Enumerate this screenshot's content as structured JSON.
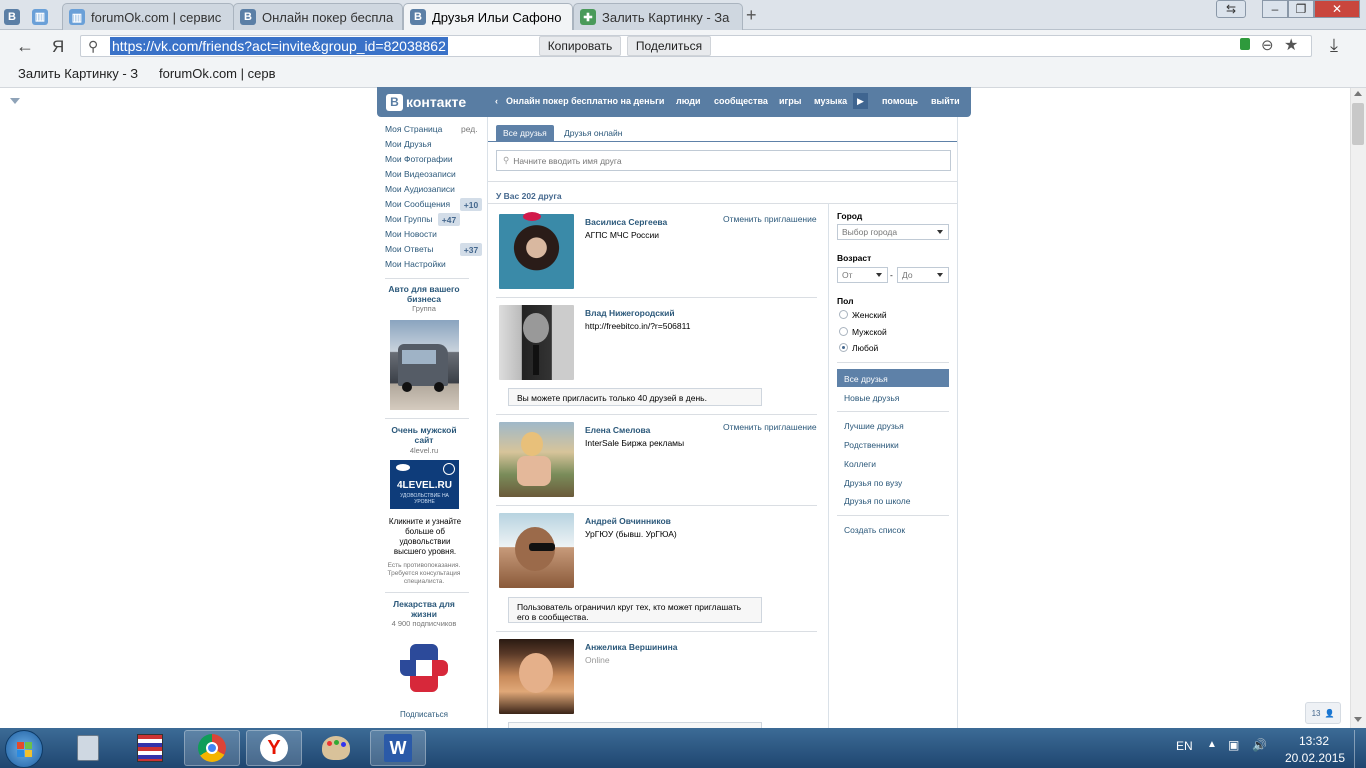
{
  "browser": {
    "tabs": [
      {
        "label": "forumOk.com | сервис"
      },
      {
        "label": "Онлайн покер беспла"
      },
      {
        "label": "Друзья Ильи Сафоно"
      },
      {
        "label": "Залить Картинку - За"
      }
    ],
    "url": "https://vk.com/friends?act=invite&group_id=82038862",
    "copy_label": "Копировать",
    "share_label": "Поделиться",
    "yandex_label": "Я",
    "bookmarks": [
      "Залить Картинку - З",
      "forumOk.com | серв"
    ]
  },
  "vk": {
    "logo": "контакте",
    "logo_b": "В",
    "nav": {
      "promo": "Онлайн покер бесплатно на деньги",
      "people": "люди",
      "communities": "сообщества",
      "games": "игры",
      "music": "музыка",
      "help": "помощь",
      "logout": "выйти"
    },
    "left_menu": {
      "my_page": "Моя Страница",
      "edit": "ред.",
      "friends": "Мои Друзья",
      "photos": "Мои Фотографии",
      "videos": "Мои Видеозаписи",
      "audio": "Мои Аудиозаписи",
      "messages": "Мои Сообщения",
      "messages_count": "+10",
      "groups": "Мои Группы",
      "groups_count": "+47",
      "news": "Мои Новости",
      "answers": "Мои Ответы",
      "answers_count": "+37",
      "settings": "Мои Настройки"
    },
    "ads": {
      "ad1_title": "Авто для вашего бизнеса",
      "ad1_sub": "Группа",
      "ad2_title": "Очень мужской сайт",
      "ad2_sub": "4level.ru",
      "ad2_logo": "4LEVEL.RU",
      "ad2_logo_sub": "УДОВОЛЬСТВИЕ НА УРОВНЕ",
      "ad2_text": "Кликните и узнайте больше об удовольствии высшего уровня.",
      "ad2_disclaimer": "Есть противопоказания. Требуется консультация специалиста.",
      "ad3_title": "Лекарства для жизни",
      "ad3_sub": "4 900 подписчиков",
      "ad3_subscribe": "Подписаться"
    },
    "tabs": {
      "all": "Все друзья",
      "online": "Друзья онлайн"
    },
    "search_placeholder": "Начните вводить имя друга",
    "friends_count": "У Вас 202 друга",
    "cancel_invite": "Отменить приглашение",
    "friends": [
      {
        "name": "Василиса Сергеева",
        "sub": "АГПС МЧС России"
      },
      {
        "name": "Влад Нижегородский",
        "sub": "http://freebitco.in/?r=506811"
      },
      {
        "name": "Елена Смелова",
        "sub": "InterSale Биржа рекламы"
      },
      {
        "name": "Андрей Овчинников",
        "sub": "УрГЮУ (бывш. УрГЮА)"
      },
      {
        "name": "Анжелика Вершинина",
        "sub": "Online"
      }
    ],
    "notice_limit": "Вы можете пригласить только 40 друзей в день.",
    "notice_restricted": "Пользователь ограничил круг тех, кто может приглашать его в сообщества.",
    "filter": {
      "city_label": "Город",
      "city_select": "Выбор города",
      "age_label": "Возраст",
      "age_from": "От",
      "age_dash": "-",
      "age_to": "До",
      "sex_label": "Пол",
      "female": "Женский",
      "male": "Мужской",
      "any": "Любой"
    },
    "lists": {
      "all": "Все друзья",
      "new": "Новые друзья",
      "best": "Лучшие друзья",
      "relatives": "Родственники",
      "colleagues": "Коллеги",
      "university": "Друзья по вузу",
      "school": "Друзья по школе",
      "create": "Создать список"
    },
    "online_badge": "13"
  },
  "taskbar": {
    "lang": "EN",
    "time": "13:32",
    "date": "20.02.2015"
  }
}
